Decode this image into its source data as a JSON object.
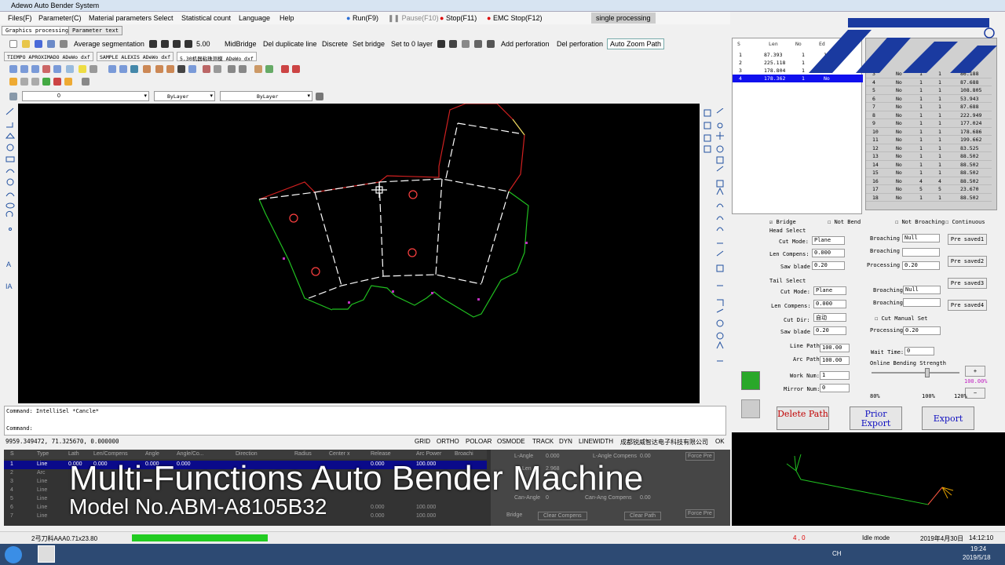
{
  "app": {
    "title": "Adewo Auto Bender System"
  },
  "menu": [
    "Files(F)",
    "Parameter(C)",
    "Material parameters Select",
    "Statistical count",
    "Language",
    "Help"
  ],
  "run": {
    "run": "Run(F9)",
    "pause": "Pause(F10)",
    "stop": "Stop(F11)",
    "emc": "EMC Stop(F12)",
    "mode": "single processing"
  },
  "tabs": [
    "Graphics processing",
    "Parameter text"
  ],
  "toolbar": {
    "avg": "Average segmentation",
    "value": "5.00",
    "items": [
      "MidBridge",
      "Del duplicate line",
      "Discrete",
      "Set bridge",
      "Set to 0 layer",
      "Add perforation",
      "Del perforation",
      "Auto Zoom Path"
    ]
  },
  "doctabs": [
    "TIEMPO APROXIMADO ADeWo dxf",
    "SAMPLE ALEXIS ADeWo dxf",
    "5.30机器粘珠测模 ADeWo dxf"
  ],
  "layer": {
    "name": "0",
    "bylayer1": "ByLayer",
    "bylayer2": "ByLayer"
  },
  "cmd": {
    "line1": "Command: IntelliSel *Cancle*",
    "line2": "Command:"
  },
  "status": {
    "coords": "9959.349472,  71.325670,  0.000000",
    "flags": [
      "GRID",
      "ORTHO",
      "POLOAR",
      "OSMODE",
      "TRACK",
      "DYN",
      "LINEWIDTH"
    ],
    "company": "成都锐威智达电子科技有限公司",
    "ok": "OK"
  },
  "grid": {
    "headers": [
      "S",
      "Type",
      "Lath",
      "Len/Compens",
      "Angle",
      "Angle/Co...",
      "Direction",
      "Radius",
      "Center x",
      "Release",
      "Arc Power",
      "Broachi"
    ],
    "rows": [
      [
        "1",
        "Line",
        "0.000",
        "0.000",
        "0.000",
        "0.000",
        "",
        "",
        "",
        "0.000",
        "100.000",
        ""
      ],
      [
        "2",
        "Arc",
        "",
        "",
        "",
        "",
        "",
        "",
        "",
        "",
        "",
        ""
      ],
      [
        "3",
        "Line",
        "",
        "",
        "",
        "",
        "",
        "",
        "",
        "",
        "",
        ""
      ],
      [
        "4",
        "Line",
        "",
        "",
        "",
        "",
        "",
        "",
        "",
        "",
        "",
        ""
      ],
      [
        "5",
        "Line",
        "",
        "",
        "",
        "",
        "",
        "",
        "",
        "",
        "",
        ""
      ],
      [
        "6",
        "Line",
        "",
        "",
        "",
        "",
        "",
        "",
        "",
        "0.000",
        "100.000",
        ""
      ],
      [
        "7",
        "Line",
        "",
        "",
        "",
        "",
        "",
        "",
        "",
        "0.000",
        "100.000",
        ""
      ]
    ],
    "right": {
      "langle": "L-Angle",
      "langle_v": "0.000",
      "lang_comp": "L-Angle Compens",
      "lang_comp_v": "0.00",
      "len": "Len",
      "len_v": "2.968",
      "can_angle": "Can-Angle",
      "can_v": "0",
      "can_ang_comp": "Can-Ang Compens",
      "can_ang_v": "0.00",
      "force1": "Force Pre",
      "force2": "Force Pre",
      "bridge": "Bridge",
      "clear1": "Clear Compens",
      "clear2": "Clear Path"
    }
  },
  "overlay": {
    "line1": "Multi-Functions Auto Bender Machine",
    "line2": "Model No.ABM-A8105B32"
  },
  "bottom": {
    "file": "2弓刀料AAA0.71x23.80",
    "pos": "4 , 0",
    "mode": "Idle mode",
    "date": "2019年4月30日",
    "time": "14:12:10"
  },
  "taskbar": {
    "clock": "19:24",
    "date": "2019/5/18",
    "lang": "CH"
  },
  "pathtable": {
    "headers": [
      "S",
      "Len",
      "No",
      "Ed"
    ],
    "rows": [
      [
        "1",
        "87.393",
        "1",
        "1"
      ],
      [
        "2",
        "225.118",
        "1",
        "1"
      ],
      [
        "3",
        "178.804",
        "1",
        "No"
      ],
      [
        "4",
        "178.362",
        "1",
        "No"
      ]
    ]
  },
  "subtable": {
    "rows": [
      [
        "3",
        "No",
        "1",
        "1",
        "86.188"
      ],
      [
        "4",
        "No",
        "1",
        "1",
        "87.688"
      ],
      [
        "5",
        "No",
        "1",
        "1",
        "108.805"
      ],
      [
        "6",
        "No",
        "1",
        "1",
        "53.943"
      ],
      [
        "7",
        "No",
        "1",
        "1",
        "87.688"
      ],
      [
        "8",
        "No",
        "1",
        "1",
        "222.949"
      ],
      [
        "9",
        "No",
        "1",
        "1",
        "177.024"
      ],
      [
        "10",
        "No",
        "1",
        "1",
        "178.686"
      ],
      [
        "11",
        "No",
        "1",
        "1",
        "199.662"
      ],
      [
        "12",
        "No",
        "1",
        "1",
        "83.525"
      ],
      [
        "13",
        "No",
        "1",
        "1",
        "88.502"
      ],
      [
        "14",
        "No",
        "1",
        "1",
        "88.502"
      ],
      [
        "15",
        "No",
        "1",
        "1",
        "88.502"
      ],
      [
        "16",
        "No",
        "4",
        "4",
        "88.502"
      ],
      [
        "17",
        "No",
        "5",
        "5",
        "23.670"
      ],
      [
        "18",
        "No",
        "1",
        "1",
        "88.502"
      ]
    ]
  },
  "form": {
    "bridge": "Bridge",
    "notbend": "Not Bend",
    "notbroach": "Not Broaching",
    "continuous": "Continuous",
    "head": "Head Select",
    "tail": "Tail Select",
    "cutmode": "Cut Mode:",
    "plane": "Plane",
    "lencomp": "Len Compens:",
    "lencomp_v": "0.000",
    "sawblade": "Saw blade",
    "saw_v": "0.20",
    "broaching": "Broaching",
    "null": "Null",
    "processing": "Processing",
    "proc_v": "0.20",
    "cutdir": "Cut Dir:",
    "cutdir_v": "自动",
    "cutmanual": "Cut Manual Set",
    "linepath": "Line Path",
    "linepath_v": "100.00",
    "arcpath": "Arc Path",
    "arcpath_v": "100.00",
    "worknum": "Work Num:",
    "worknum_v": "1",
    "mirror": "Mirror Num:",
    "mirror_v": "0",
    "wait": "Wait Time:",
    "wait_v": "0",
    "strength": "Online Bending Strength",
    "pct": "100.00%",
    "p80": "80%",
    "p100": "100%",
    "p120": "120%",
    "pre": [
      "Pre saved1",
      "Pre saved2",
      "Pre saved3",
      "Pre saved4"
    ],
    "del": "Delete Path",
    "prior": "Prior Export",
    "export": "Export"
  },
  "colors": {
    "accent": "#1010ee",
    "green": "#22cc22",
    "red": "#ff0000"
  }
}
